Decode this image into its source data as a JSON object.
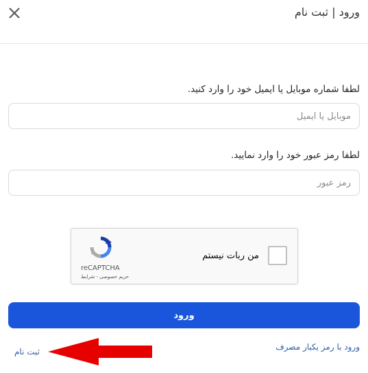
{
  "header": {
    "title": "ورود | ثبت نام"
  },
  "form": {
    "mobile_label": "لطفا شماره موبایل یا ایمیل خود را وارد کنید.",
    "mobile_placeholder": "موبایل یا ایمیل",
    "mobile_value": "",
    "password_label": "لطفا رمز عبور خود را وارد نمایید.",
    "password_placeholder": "رمز عبور",
    "password_value": "",
    "submit_label": "ورود"
  },
  "captcha": {
    "label": "من ربات نیستم",
    "brand": "reCAPTCHA",
    "links": "حریم خصوصی - شرایط",
    "checked": false
  },
  "links": {
    "otp_login": "ورود با رمز یکبار مصرف",
    "register": "ثبت نام"
  },
  "colors": {
    "primary": "#1a56db",
    "link": "#2f5ea8",
    "annotation_arrow": "#e60000"
  },
  "icons": {
    "close": "close-icon",
    "captcha": "recaptcha-logo-icon",
    "annotation": "arrow-left-icon"
  }
}
